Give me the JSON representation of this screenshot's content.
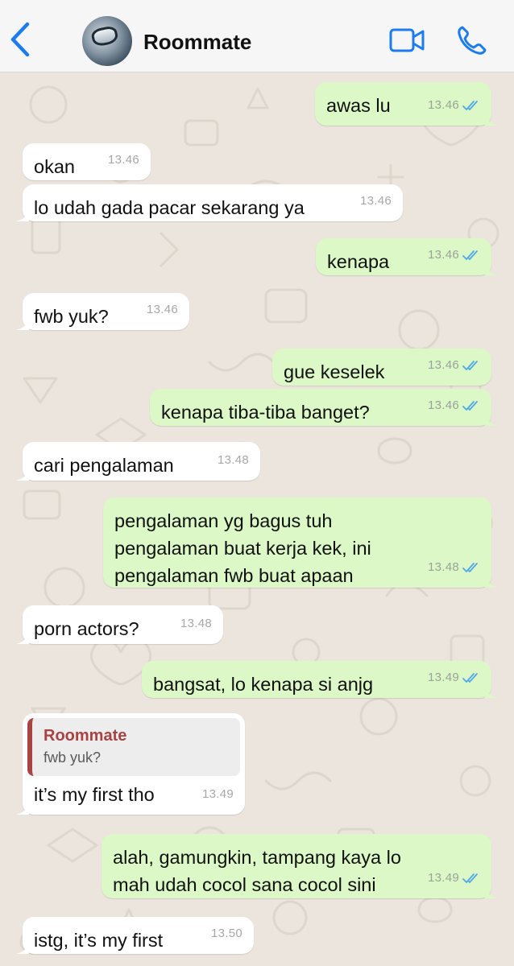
{
  "header": {
    "contact_name": "Roommate",
    "icons": {
      "back": "chevron-left-icon",
      "video": "video-call-icon",
      "phone": "phone-icon"
    },
    "accent_color": "#1a7cf0"
  },
  "colors": {
    "outgoing_bubble": "#dcf8c6",
    "incoming_bubble": "#ffffff",
    "read_ticks": "#4fa8e8",
    "quote_accent": "#a94343"
  },
  "messages": [
    {
      "direction": "out",
      "text": "awas lu",
      "time": "13.46",
      "read": true
    },
    {
      "direction": "in",
      "text": "okan",
      "time": "13.46"
    },
    {
      "direction": "in",
      "text": "lo udah gada pacar sekarang ya",
      "time": "13.46"
    },
    {
      "direction": "out",
      "text": "kenapa",
      "time": "13.46",
      "read": true
    },
    {
      "direction": "in",
      "text": "fwb yuk?",
      "time": "13.46"
    },
    {
      "direction": "out",
      "text": "gue keselek",
      "time": "13.46",
      "read": true
    },
    {
      "direction": "out",
      "text": "kenapa tiba-tiba banget?",
      "time": "13.46",
      "read": true
    },
    {
      "direction": "in",
      "text": "cari pengalaman",
      "time": "13.48"
    },
    {
      "direction": "out",
      "text": "pengalaman yg bagus tuh pengalaman buat kerja kek, ini pengalaman fwb buat apaan",
      "time": "13.48",
      "read": true
    },
    {
      "direction": "in",
      "text": "porn actors?",
      "time": "13.48"
    },
    {
      "direction": "out",
      "text": "bangsat, lo kenapa si anjg",
      "time": "13.49",
      "read": true
    },
    {
      "direction": "in",
      "text": "it’s my first tho",
      "time": "13.49",
      "quote": {
        "name": "Roommate",
        "text": "fwb yuk?"
      }
    },
    {
      "direction": "out",
      "text": "alah, gamungkin, tampang kaya lo mah udah cocol sana cocol sini",
      "time": "13.49",
      "read": true
    },
    {
      "direction": "in",
      "text": "istg, it’s my first",
      "time": "13.50"
    }
  ]
}
